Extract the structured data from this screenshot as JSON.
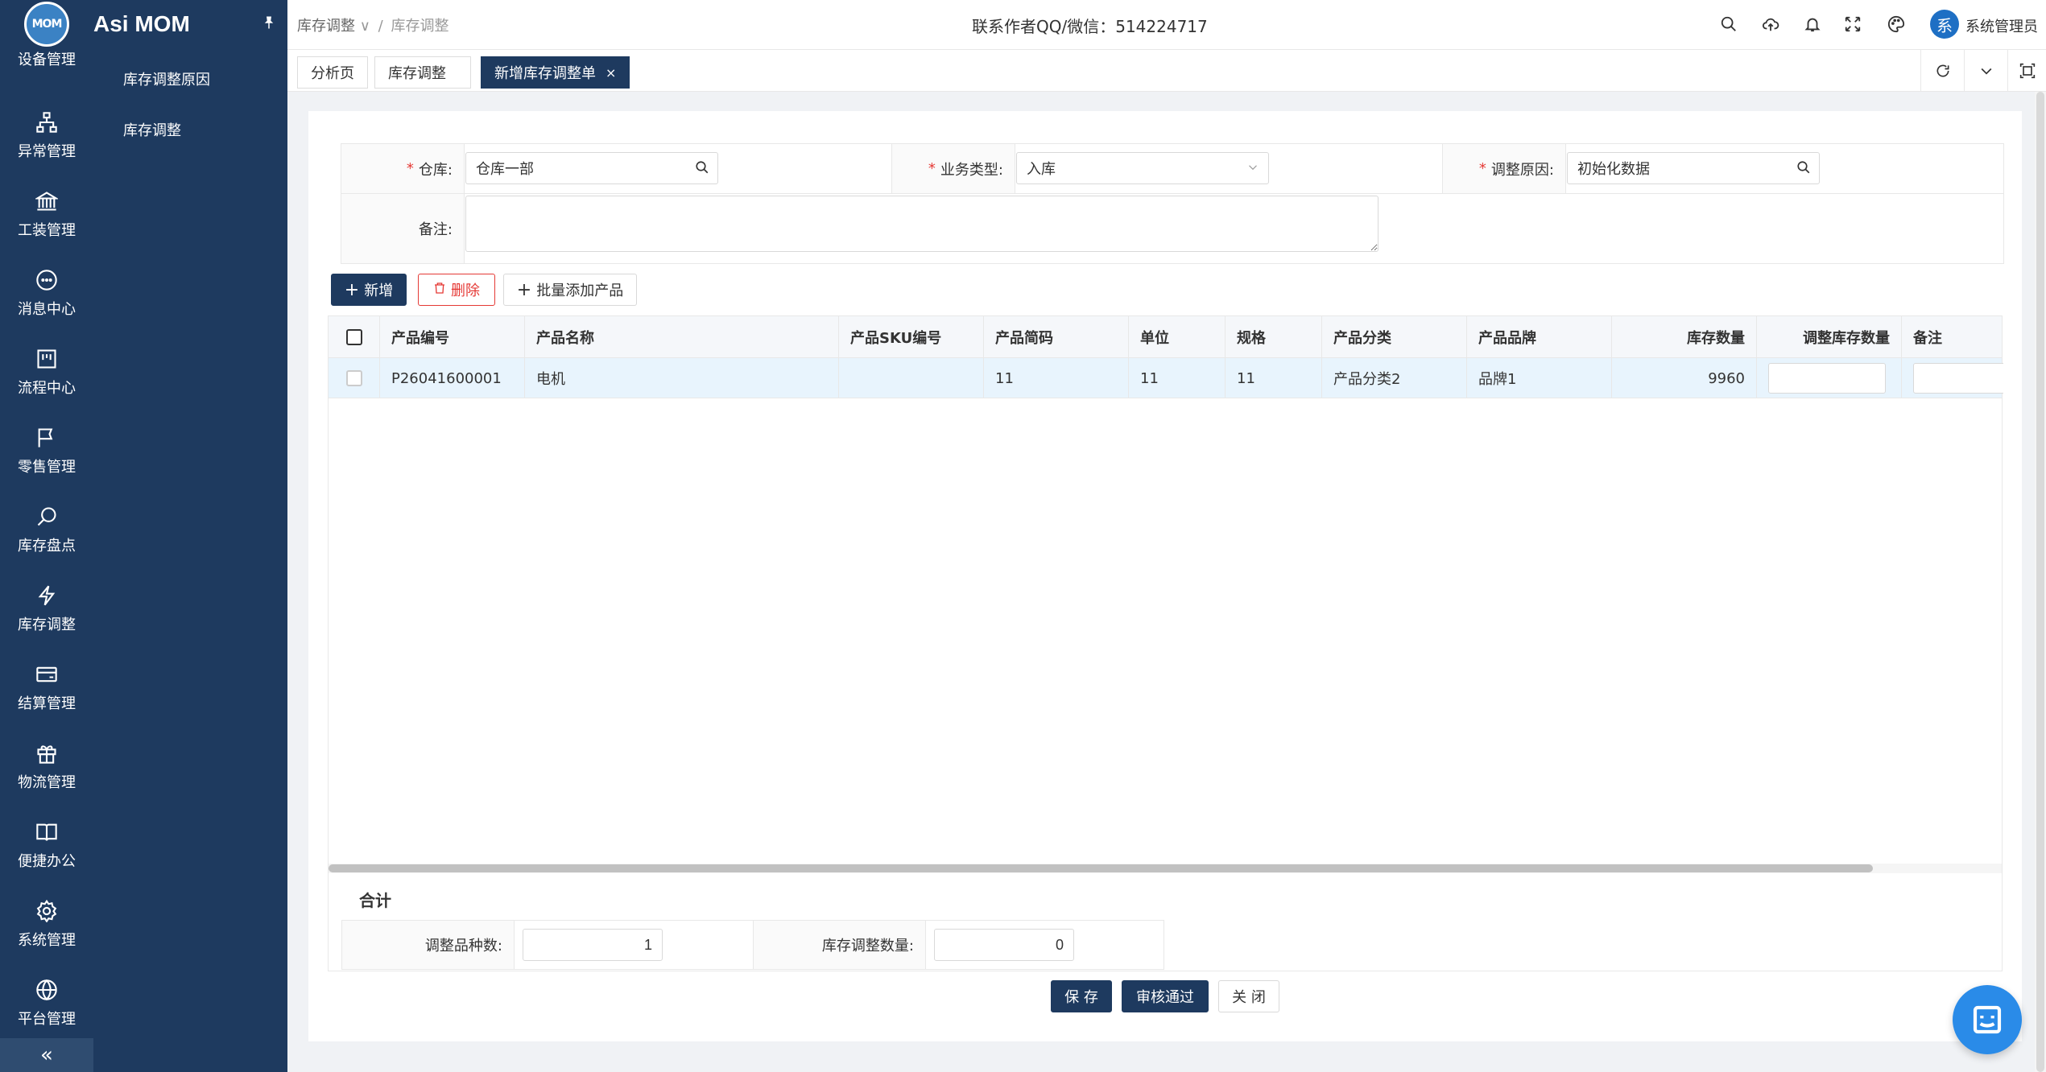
{
  "brand": {
    "logo_text": "MOM",
    "name": "Asi MOM",
    "pin_icon": "pin-icon"
  },
  "rail": {
    "items": [
      {
        "label": "设备管理",
        "icon": "device-icon"
      },
      {
        "label": "异常管理",
        "icon": "hierarchy-icon"
      },
      {
        "label": "工装管理",
        "icon": "bank-icon"
      },
      {
        "label": "消息中心",
        "icon": "message-icon"
      },
      {
        "label": "流程中心",
        "icon": "flow-icon"
      },
      {
        "label": "零售管理",
        "icon": "flag-icon"
      },
      {
        "label": "库存盘点",
        "icon": "search-check-icon"
      },
      {
        "label": "库存调整",
        "icon": "lightning-icon"
      },
      {
        "label": "结算管理",
        "icon": "card-icon"
      },
      {
        "label": "物流管理",
        "icon": "gift-icon"
      },
      {
        "label": "便捷办公",
        "icon": "book-icon"
      },
      {
        "label": "系统管理",
        "icon": "gear-icon"
      },
      {
        "label": "平台管理",
        "icon": "globe-icon"
      }
    ],
    "collapse": "«"
  },
  "submenu": {
    "items": [
      {
        "label": "库存调整原因"
      },
      {
        "label": "库存调整"
      }
    ]
  },
  "header": {
    "breadcrumb": [
      "库存调整",
      "库存调整"
    ],
    "contact": "联系作者QQ/微信：514224717",
    "avatar_text": "系",
    "username": "系统管理员"
  },
  "tabs": [
    {
      "label": "分析页",
      "active": false
    },
    {
      "label": "库存调整",
      "active": false
    },
    {
      "label": "新增库存调整单",
      "active": true,
      "close": "×"
    }
  ],
  "form": {
    "warehouse": {
      "label": "仓库:",
      "value": "仓库一部"
    },
    "business_type": {
      "label": "业务类型:",
      "value": "入库"
    },
    "reason": {
      "label": "调整原因:",
      "value": "初始化数据"
    },
    "remark": {
      "label": "备注:",
      "value": ""
    }
  },
  "toolbar": {
    "add": "新增",
    "delete": "删除",
    "batch_add": "批量添加产品"
  },
  "table": {
    "columns": [
      "产品编号",
      "产品名称",
      "产品SKU编号",
      "产品简码",
      "单位",
      "规格",
      "产品分类",
      "产品品牌",
      "库存数量",
      "调整库存数量",
      "备注"
    ],
    "rows": [
      {
        "code": "P26041600001",
        "name": "电机",
        "sku": "",
        "short_code": "11",
        "unit": "11",
        "spec": "11",
        "category": "产品分类2",
        "brand": "品牌1",
        "stock": "9960",
        "adjust_qty": "",
        "remark": ""
      }
    ]
  },
  "summary": {
    "title": "合计",
    "kinds_label": "调整品种数:",
    "kinds_value": "1",
    "qty_label": "库存调整数量:",
    "qty_value": "0"
  },
  "actions": {
    "save": "保 存",
    "approve": "审核通过",
    "close": "关 闭"
  },
  "colors": {
    "sidebar": "#1e3a5f",
    "primary": "#1e3a5f",
    "danger": "#e53935",
    "row_highlight": "#e8f4fd",
    "fab": "#2a8be8"
  }
}
